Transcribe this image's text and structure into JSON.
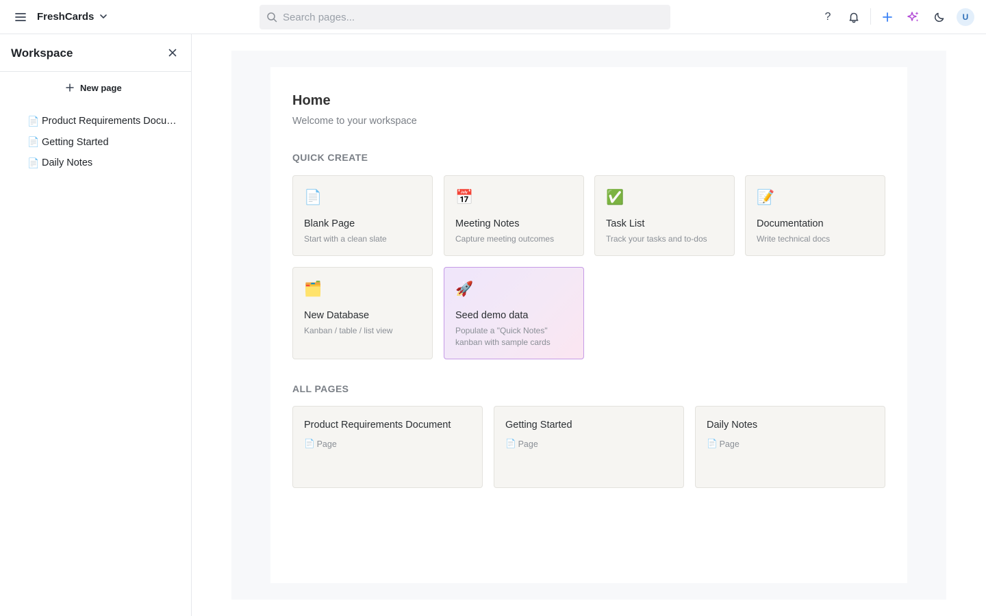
{
  "topbar": {
    "brand": "FreshCards",
    "search_placeholder": "Search pages...",
    "help_label": "?",
    "avatar_initial": "U"
  },
  "sidebar": {
    "title": "Workspace",
    "new_page_label": "New page",
    "items": [
      {
        "label": "Product Requirements Document",
        "icon": "📄"
      },
      {
        "label": "Getting Started",
        "icon": "📄"
      },
      {
        "label": "Daily Notes",
        "icon": "📄"
      }
    ]
  },
  "main": {
    "title": "Home",
    "subtitle": "Welcome to your workspace",
    "quick_create_title": "QUICK CREATE",
    "quick_create": [
      {
        "icon": "📄",
        "title": "Blank Page",
        "desc": "Start with a clean slate"
      },
      {
        "icon": "📅",
        "title": "Meeting Notes",
        "desc": "Capture meeting outcomes"
      },
      {
        "icon": "✅",
        "title": "Task List",
        "desc": "Track your tasks and to-dos"
      },
      {
        "icon": "📝",
        "title": "Documentation",
        "desc": "Write technical docs"
      },
      {
        "icon": "🗂️",
        "title": "New Database",
        "desc": "Kanban / table / list view"
      },
      {
        "icon": "🚀",
        "title": "Seed demo data",
        "desc": "Populate a \"Quick Notes\" kanban with sample cards"
      }
    ],
    "all_pages_title": "ALL PAGES",
    "all_pages": [
      {
        "title": "Product Requirements Document",
        "icon": "📄",
        "type": "Page"
      },
      {
        "title": "Getting Started",
        "icon": "📄",
        "type": "Page"
      },
      {
        "title": "Daily Notes",
        "icon": "📄",
        "type": "Page"
      }
    ]
  },
  "colors": {
    "accent_blue": "#3b82f6",
    "sparkle_purple": "#b24bd6",
    "seed_border": "#c59ae6"
  }
}
